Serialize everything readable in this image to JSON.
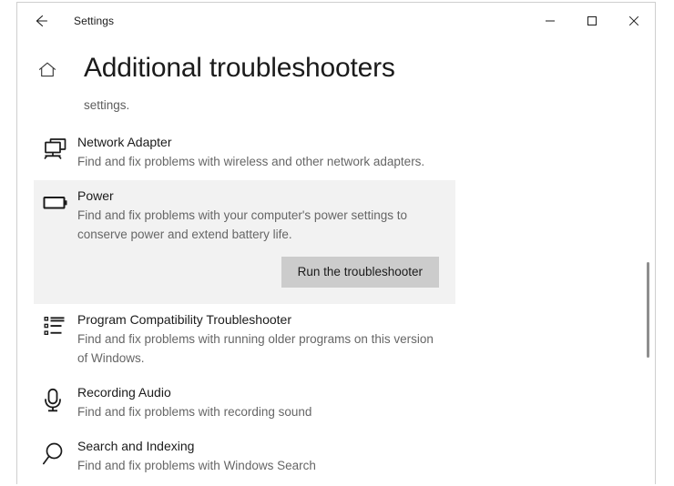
{
  "window": {
    "app_title": "Settings",
    "back_icon": "back-arrow-icon",
    "minimize_label": "Minimize",
    "maximize_label": "Maximize",
    "close_label": "Close"
  },
  "header": {
    "home_icon": "home-icon",
    "title": "Additional troubleshooters",
    "intro_text": "settings."
  },
  "troubleshooters": [
    {
      "icon": "network-adapter-icon",
      "title": "Network Adapter",
      "description": "Find and fix problems with wireless and other network adapters.",
      "selected": false,
      "button": null
    },
    {
      "icon": "battery-icon",
      "title": "Power",
      "description": "Find and fix problems with your computer's power settings to conserve power and extend battery life.",
      "selected": true,
      "button": "Run the troubleshooter"
    },
    {
      "icon": "list-icon",
      "title": "Program Compatibility Troubleshooter",
      "description": "Find and fix problems with running older programs on this version of Windows.",
      "selected": false,
      "button": null
    },
    {
      "icon": "microphone-icon",
      "title": "Recording Audio",
      "description": "Find and fix problems with recording sound",
      "selected": false,
      "button": null
    },
    {
      "icon": "search-icon",
      "title": "Search and Indexing",
      "description": "Find and fix problems with Windows Search",
      "selected": false,
      "button": null
    }
  ],
  "scrollbar": {
    "name": "vertical-scrollbar"
  },
  "colors": {
    "selected_background": "#f2f2f2",
    "button_background": "#cccccc",
    "text_primary": "#1b1b1b",
    "text_secondary": "#666666",
    "scrollbar_thumb": "#8e8e8e"
  }
}
